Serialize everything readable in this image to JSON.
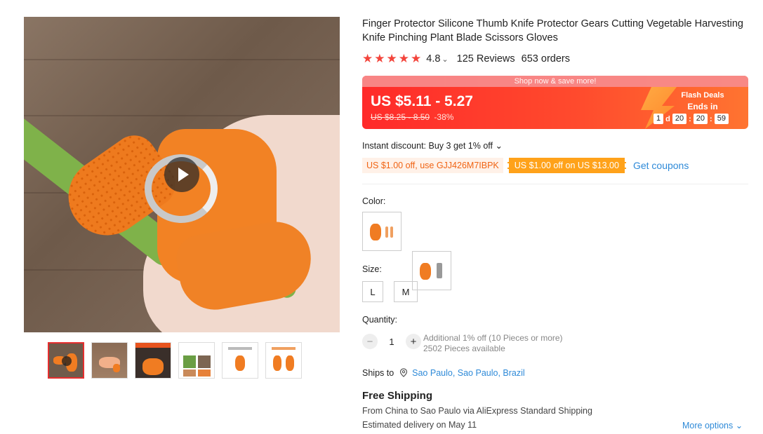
{
  "product": {
    "title": "Finger Protector Silicone Thumb Knife Protector Gears Cutting Vegetable Harvesting Knife Pinching Plant Blade Scissors Gloves",
    "rating": "4.8",
    "rating_chevron": "⌄",
    "reviews": "125 Reviews",
    "orders": "653 orders",
    "stars": 5
  },
  "flash": {
    "banner": "Shop now & save more!",
    "price": "US $5.11 - 5.27",
    "old_price": "US $8.25 - 8.50",
    "discount": "-38%",
    "deal_label": "Flash Deals",
    "ends_label": "Ends in",
    "days": "1",
    "days_unit": "d",
    "hours": "20",
    "minutes": "20",
    "seconds": "59",
    "sep": ":"
  },
  "instant_discount": "Instant discount: Buy 3 get 1% off ⌄",
  "coupons": {
    "code_coupon": "US $1.00 off, use GJJ426M7IBPK",
    "store_coupon": "US $1.00 off on US $13.00",
    "get_coupons": "Get coupons"
  },
  "color": {
    "label": "Color:"
  },
  "size": {
    "label": "Size:",
    "options": [
      "L",
      "M"
    ]
  },
  "quantity": {
    "label": "Quantity:",
    "value": "1",
    "minus": "−",
    "plus": "+",
    "note1": "Additional 1% off (10 Pieces or more)",
    "note2": "2502 Pieces available"
  },
  "shipping": {
    "ships_to_label": "Ships to",
    "destination": "Sao Paulo, Sao Paulo, Brazil",
    "free_shipping": "Free Shipping",
    "route": "From China to Sao Paulo via AliExpress Standard Shipping",
    "estimated": "Estimated delivery on May 11",
    "more_options": "More options ⌄"
  },
  "colors": {
    "accent": "#f3443b",
    "link": "#2e8ad8",
    "coupon": "#ffa21a"
  }
}
